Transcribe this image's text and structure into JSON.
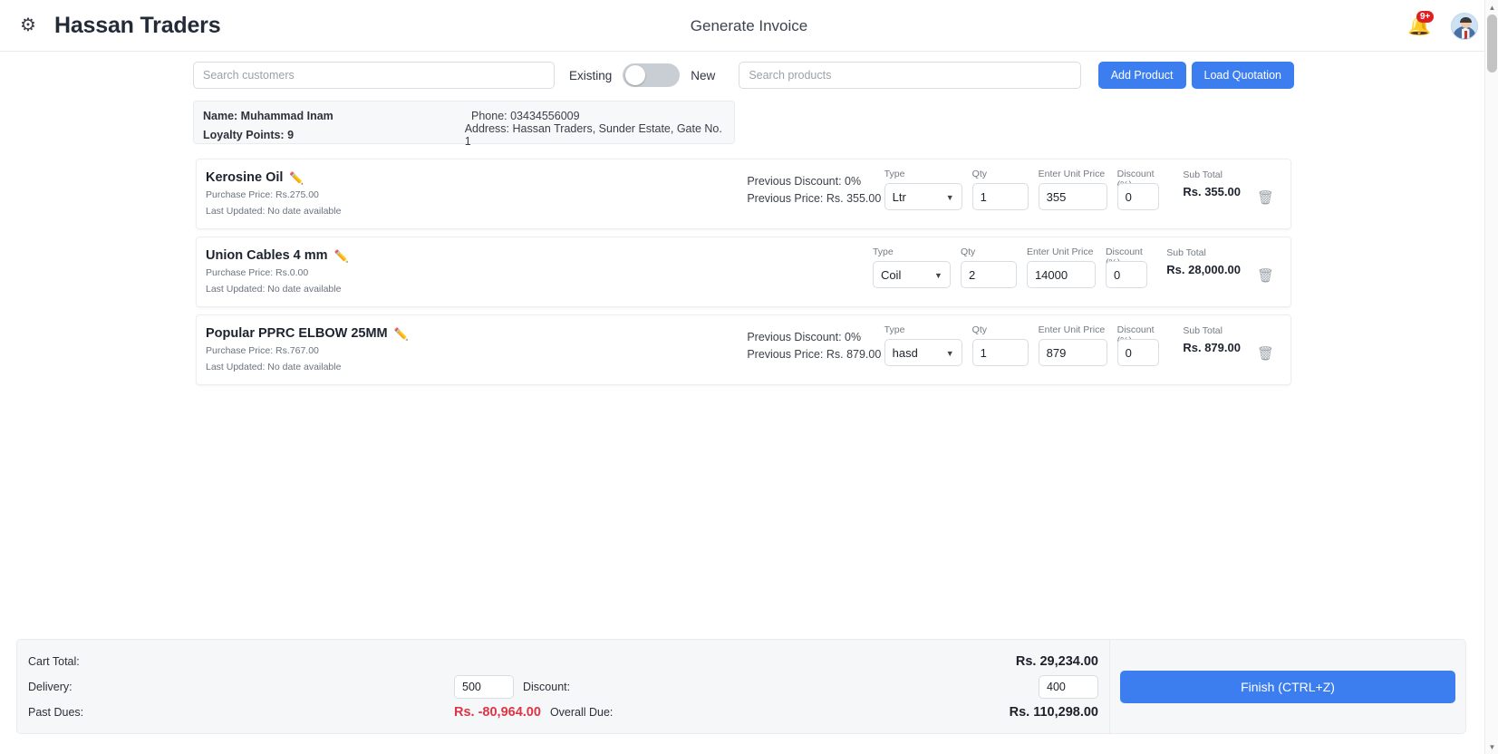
{
  "header": {
    "brand": "Hassan Traders",
    "logo_icon": "gear-logo-icon",
    "title": "Generate Invoice",
    "bell_icon": "bell-icon",
    "bell_badge": "9+",
    "avatar_icon": "user-avatar-icon"
  },
  "search": {
    "customer_placeholder": "Search customers",
    "customer_value": "",
    "toggle_left_label": "Existing",
    "toggle_right_label": "New",
    "toggle_state": "off",
    "product_placeholder": "Search products",
    "product_value": "",
    "add_product_label": "Add Product",
    "load_quotation_label": "Load Quotation"
  },
  "customer": {
    "name": "Name: Muhammad Inam",
    "phone": "Phone: 03434556009",
    "loyalty": "Loyalty Points: 9",
    "address": "Address: Hassan Traders, Sunder Estate, Gate No. 1"
  },
  "labels": {
    "type": "Type",
    "qty": "Qty",
    "unit_price": "Enter Unit Price",
    "discount": "Discount (%)",
    "sub_total": "Sub Total",
    "edit_icon": "pencil-icon",
    "delete_icon": "trash-icon",
    "caret_icon": "chevron-down-icon"
  },
  "items": [
    {
      "name": "Kerosine Oil",
      "purchase_price": "Purchase Price: Rs.275.00",
      "last_updated": "Last Updated: No date available",
      "previous_discount": "Previous Discount: 0%",
      "previous_price": "Previous Price: Rs. 355.00",
      "type": "Ltr",
      "qty": "1",
      "unit_price": "355",
      "discount": "0",
      "sub_total": "Rs. 355.00"
    },
    {
      "name": "Union Cables 4 mm",
      "purchase_price": "Purchase Price: Rs.0.00",
      "last_updated": "Last Updated: No date available",
      "previous_discount": "",
      "previous_price": "",
      "type": "Coil",
      "qty": "2",
      "unit_price": "14000",
      "discount": "0",
      "sub_total": "Rs. 28,000.00"
    },
    {
      "name": "Popular PPRC ELBOW 25MM",
      "purchase_price": "Purchase Price: Rs.767.00",
      "last_updated": "Last Updated: No date available",
      "previous_discount": "Previous Discount: 0%",
      "previous_price": "Previous Price: Rs. 879.00",
      "type": "hasd",
      "qty": "1",
      "unit_price": "879",
      "discount": "0",
      "sub_total": "Rs. 879.00"
    }
  ],
  "totals": {
    "cart_total_label": "Cart Total:",
    "cart_total_value": "Rs. 29,234.00",
    "delivery_label": "Delivery:",
    "delivery_value": "500",
    "discount_label": "Discount:",
    "discount_value": "400",
    "past_dues_label": "Past Dues:",
    "past_dues_value": "Rs. -80,964.00",
    "overall_due_label": "Overall Due:",
    "overall_due_value": "Rs. 110,298.00",
    "finish_label": "Finish (CTRL+Z)"
  },
  "colors": {
    "accent": "#3c7ef0",
    "danger": "#dc3545",
    "badge": "#e02020"
  }
}
